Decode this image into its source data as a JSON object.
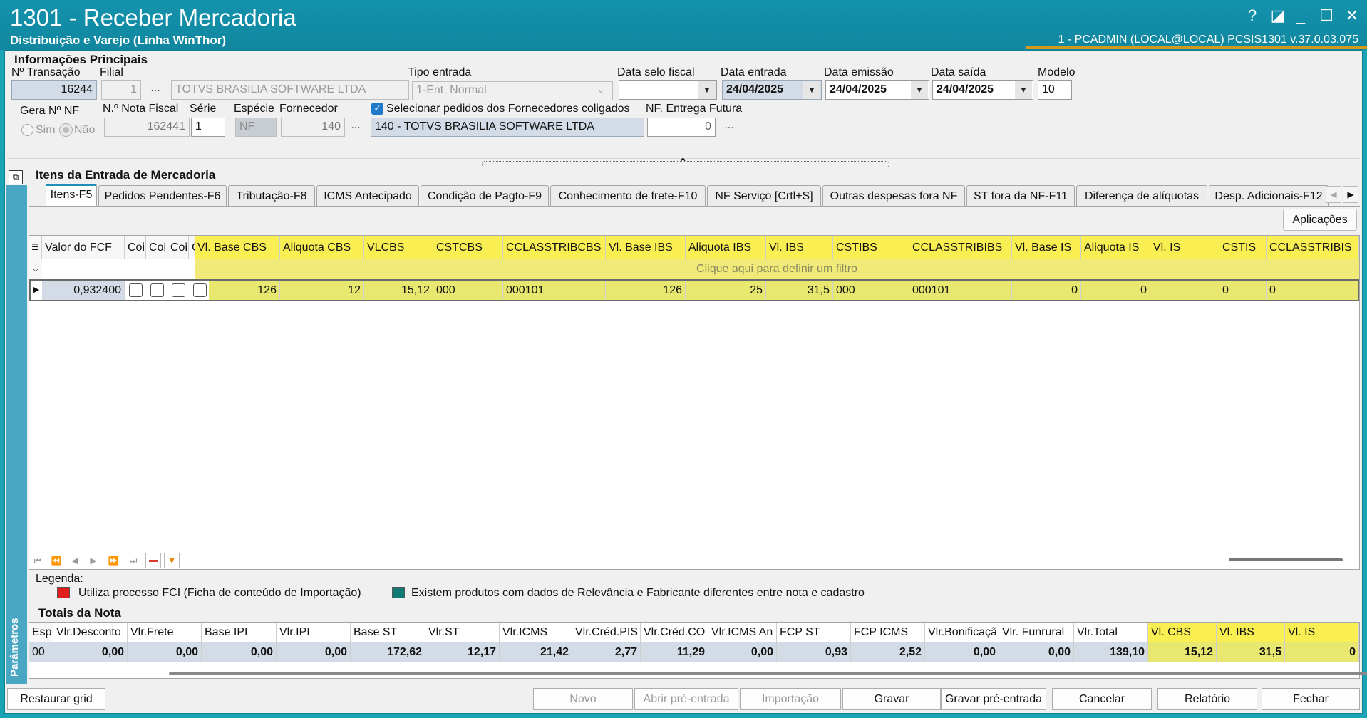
{
  "window": {
    "title": "1301 - Receber Mercadoria",
    "subtitle": "Distribuição e Varejo (Linha WinThor)",
    "user_info": "1 - PCADMIN (LOCAL@LOCAL)   PCSIS1301  v.37.0.03.075",
    "controls": {
      "help": "?",
      "edit": "◪",
      "minimize": "_",
      "maximize": "☐",
      "close": "✕"
    }
  },
  "header": {
    "section_title": "Informações Principais",
    "transacao": {
      "label": "Nº Transação",
      "value": "16244"
    },
    "filial": {
      "label": "Filial",
      "value": "1",
      "name": "TOTVS BRASILIA SOFTWARE LTDA"
    },
    "tipo_entrada": {
      "label": "Tipo entrada",
      "value": "1-Ent. Normal"
    },
    "data_selo_fiscal": {
      "label": "Data selo fiscal",
      "value": ""
    },
    "data_entrada": {
      "label": "Data entrada",
      "value": "24/04/2025"
    },
    "data_emissao": {
      "label": "Data emissão",
      "value": "24/04/2025"
    },
    "data_saida": {
      "label": "Data saída",
      "value": "24/04/2025"
    },
    "modelo": {
      "label": "Modelo",
      "value": "10"
    },
    "gera_nf": {
      "label": "Gera Nº NF",
      "sim": "Sim",
      "nao": "Não"
    },
    "nota_fiscal": {
      "label": "N.º Nota Fiscal",
      "value": "162441"
    },
    "serie": {
      "label": "Série",
      "value": "1"
    },
    "especie": {
      "label": "Espécie",
      "value": "NF"
    },
    "fornecedor": {
      "label": "Fornecedor",
      "value": "140",
      "name": "140 - TOTVS BRASILIA SOFTWARE LTDA"
    },
    "coligados": {
      "label": "Selecionar pedidos dos Fornecedores coligados",
      "checked": true
    },
    "entrega_futura": {
      "label": "NF. Entrega Futura",
      "value": "0"
    },
    "ellipsis": "..."
  },
  "items": {
    "section_title": "Itens da Entrada de Mercadoria",
    "side_label": "Parâmetros",
    "tabs": [
      "Itens-F5",
      "Pedidos Pendentes-F6",
      "Tributação-F8",
      "ICMS Antecipado",
      "Condição de Pagto-F9",
      "Conhecimento de frete-F10",
      "NF Serviço [Crtl+S]",
      "Outras despesas fora NF",
      "ST fora da NF-F11",
      "Diferença de alíquotas",
      "Desp. Adicionais-F12"
    ],
    "aplicacoes_button": "Aplicações",
    "filter_hint": "Clique aqui para definir um filtro",
    "columns": [
      "Valor do FCF",
      "Coi",
      "Coi",
      "Coi",
      "Coi",
      "Vl. Base CBS",
      "Aliquota CBS",
      "VLCBS",
      "CSTCBS",
      "CCLASSTRIBCBS",
      "Vl. Base IBS",
      "Aliquota IBS",
      "Vl. IBS",
      "CSTIBS",
      "CCLASSTRIBIBS",
      "Vl. Base IS",
      "Aliquota IS",
      "Vl. IS",
      "CSTIS",
      "CCLASSTRIBIS"
    ],
    "row": {
      "valor_fcf": "0,932400",
      "vl_base_cbs": "126",
      "aliquota_cbs": "12",
      "vlcbs": "15,12",
      "cstcbs": "000",
      "cclasstribcbs": "000101",
      "vl_base_ibs": "126",
      "aliquota_ibs": "25",
      "vl_ibs": "31,5",
      "cstibs": "000",
      "cclasstribibs": "000101",
      "vl_base_is": "0",
      "aliquota_is": "0",
      "vl_is": "",
      "cstis": "0",
      "cclasstribis": "0"
    }
  },
  "legend": {
    "title": "Legenda:",
    "items": [
      {
        "color": "#e21d1d",
        "text": "Utiliza processo FCI (Ficha de conteúdo de Importação)"
      },
      {
        "color": "#0f7b74",
        "text": "Existem produtos com dados de Relevância e Fabricante diferentes entre nota e cadastro"
      }
    ]
  },
  "totals": {
    "title": "Totais da Nota",
    "columns": [
      "Esp.",
      "Vlr.Desconto",
      "Vlr.Frete",
      "Base IPI",
      "Vlr.IPI",
      "Base ST",
      "Vlr.ST",
      "Vlr.ICMS",
      "Vlr.Créd.PIS",
      "Vlr.Créd.CO",
      "Vlr.ICMS An",
      "FCP ST",
      "FCP ICMS",
      "Vlr.Bonificaçã",
      "Vlr. Funrural",
      "Vlr.Total",
      "Vl. CBS",
      "Vl. IBS",
      "Vl. IS"
    ],
    "values": [
      "00",
      "0,00",
      "0,00",
      "0,00",
      "0,00",
      "172,62",
      "12,17",
      "21,42",
      "2,77",
      "11,29",
      "0,00",
      "0,93",
      "2,52",
      "0,00",
      "0,00",
      "139,10",
      "15,12",
      "31,5",
      "0"
    ]
  },
  "footer": {
    "restaurar_grid": "Restaurar grid",
    "novo": "Novo",
    "abrir_pre_entrada": "Abrir pré-entrada",
    "importacao": "Importação",
    "gravar": "Gravar",
    "gravar_pre_entrada": "Gravar pré-entrada",
    "cancelar": "Cancelar",
    "relatorio": "Relatório",
    "fechar": "Fechar"
  }
}
